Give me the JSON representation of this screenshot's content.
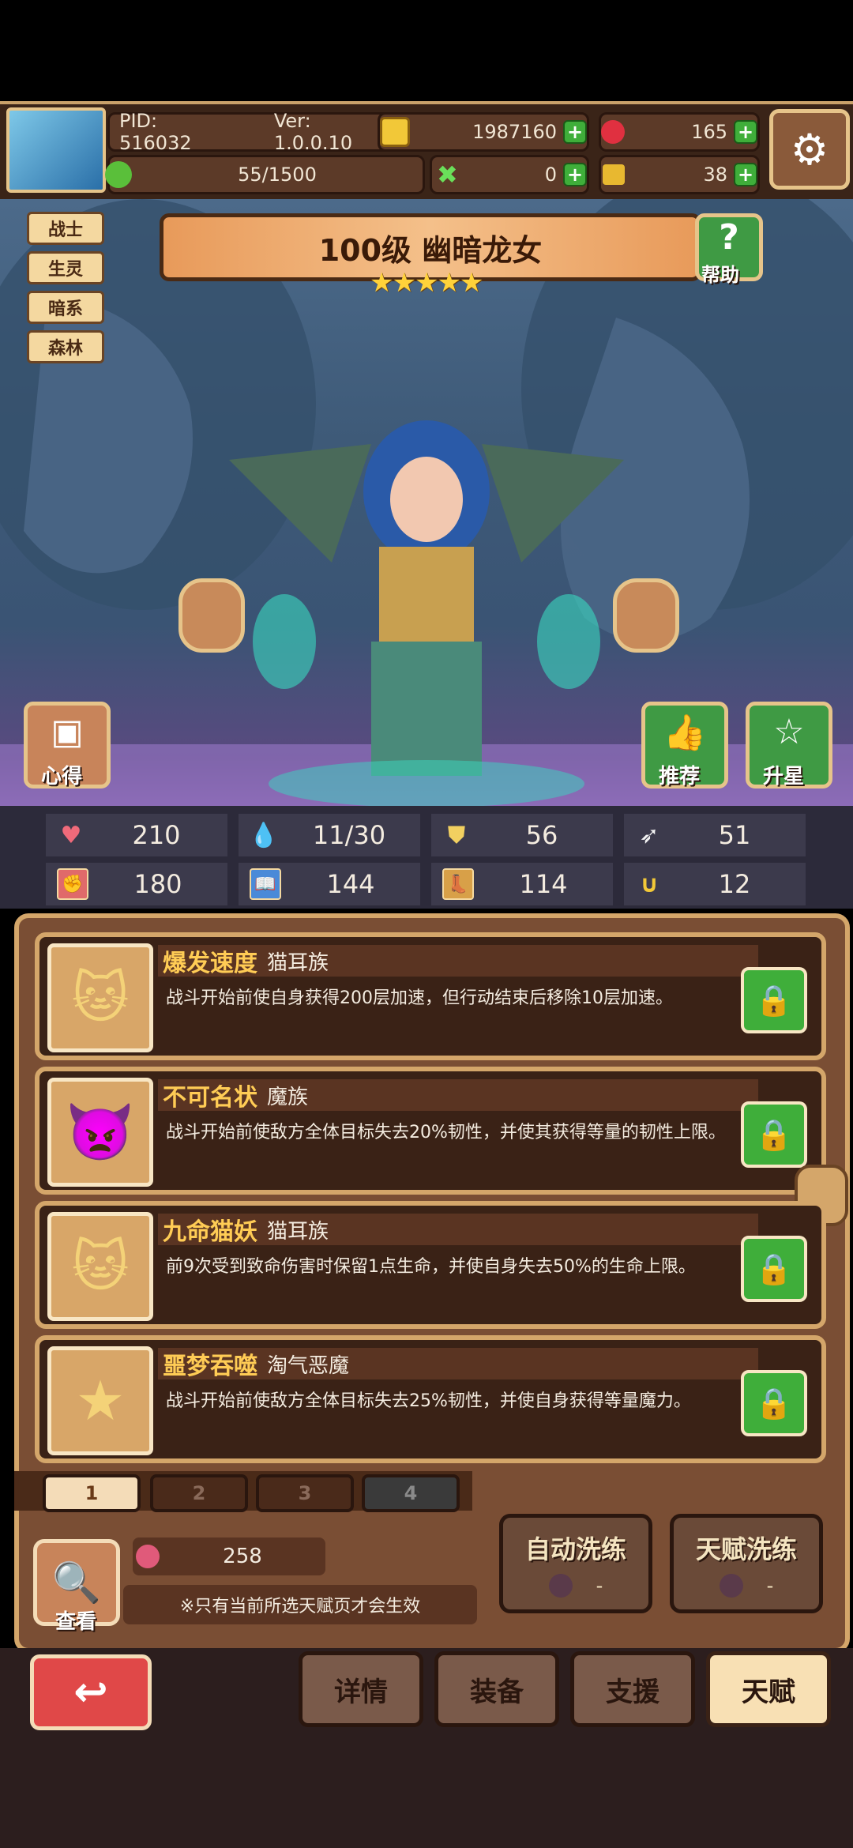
{
  "header": {
    "pid": "PID: 516032",
    "version": "Ver: 1.0.0.10",
    "gold": "1987160",
    "gems": "165",
    "stamina": "55/1500",
    "clover": "0",
    "boots": "38"
  },
  "tags": [
    "战士",
    "生灵",
    "暗系",
    "森林"
  ],
  "hero": {
    "title": "100级 幽暗龙女",
    "stars": "★★★★★",
    "help_label": "帮助",
    "notes_label": "心得",
    "recommend_label": "推荐",
    "upstar_label": "升星"
  },
  "stats": [
    {
      "icon": "heart-icon",
      "value": "210"
    },
    {
      "icon": "drop-icon",
      "value": "11/30"
    },
    {
      "icon": "shield-icon",
      "value": "56"
    },
    {
      "icon": "wing-icon",
      "value": "51"
    },
    {
      "icon": "fist-icon",
      "value": "180"
    },
    {
      "icon": "book-icon",
      "value": "144"
    },
    {
      "icon": "boot-icon",
      "value": "114"
    },
    {
      "icon": "horseshoe-icon",
      "value": "12"
    }
  ],
  "talents": [
    {
      "name": "爆发速度",
      "race": "猫耳族",
      "desc": "战斗开始前使自身获得200层加速，但行动结束后移除10层加速。",
      "icon": "cat-icon"
    },
    {
      "name": "不可名状",
      "race": "魔族",
      "desc": "战斗开始前使敌方全体目标失去20%韧性，并使其获得等量的韧性上限。",
      "icon": "demon-icon"
    },
    {
      "name": "九命猫妖",
      "race": "猫耳族",
      "desc": "前9次受到致命伤害时保留1点生命，并使自身失去50%的生命上限。",
      "icon": "cat-icon"
    },
    {
      "name": "噩梦吞噬",
      "race": "淘气恶魔",
      "desc": "战斗开始前使敌方全体目标失去25%韧性，并使自身获得等量魔力。",
      "icon": "star-icon"
    }
  ],
  "pages": [
    "1",
    "2",
    "3",
    "4"
  ],
  "footer": {
    "view_label": "查看",
    "potion_count": "258",
    "note": "※只有当前所选天赋页才会生效",
    "auto_refine": "自动洗练",
    "auto_refine_cost": "-",
    "talent_refine": "天赋洗练",
    "talent_refine_cost": "-"
  },
  "nav": {
    "details": "详情",
    "equipment": "装备",
    "support": "支援",
    "talent": "天赋"
  }
}
